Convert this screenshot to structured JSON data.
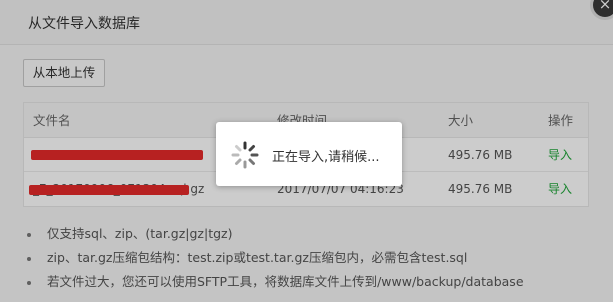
{
  "dialog": {
    "title": "从文件导入数据库",
    "close_icon": "×"
  },
  "toolbar": {
    "upload_label": "从本地上传"
  },
  "table": {
    "headers": {
      "name": "文件名",
      "time": "修改时间",
      "size": "大小",
      "op": "操作"
    },
    "rows": [
      {
        "name": "",
        "time": "",
        "size": "495.76 MB",
        "op": "导入"
      },
      {
        "name": "_7_20170906_071304.sql.gz",
        "time": "2017/07/07 04:16:23",
        "size": "495.76 MB",
        "op": "导入"
      }
    ]
  },
  "notes": [
    "仅支持sql、zip、(tar.gz|gz|tgz)",
    "zip、tar.gz压缩包结构：test.zip或test.tar.gz压缩包内，必需包含test.sql",
    "若文件过大，您还可以使用SFTP工具，将数据库文件上传到/www/backup/database"
  ],
  "loading": {
    "text": "正在导入,请稍候...",
    "icon": "spinner-icon"
  },
  "colors": {
    "accent": "#20a53a",
    "redaction": "#e52a2a"
  }
}
